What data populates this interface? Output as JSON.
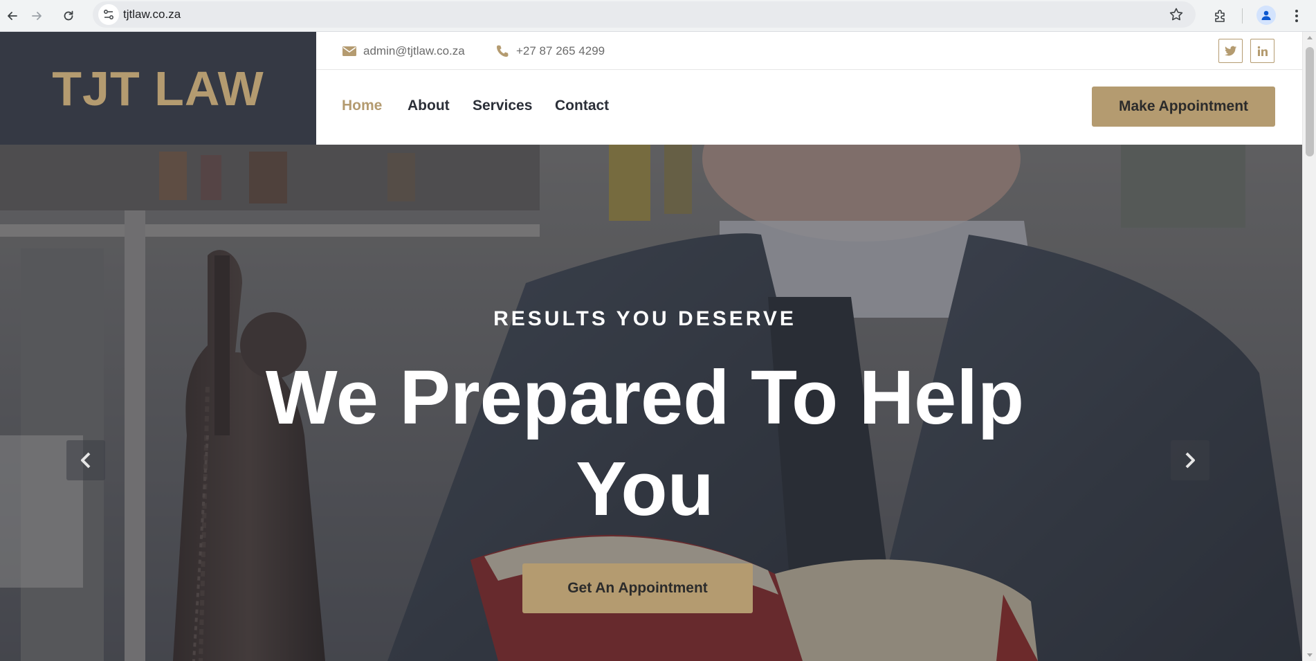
{
  "browser": {
    "url": "tjtlaw.co.za",
    "icons": {
      "back": "arrow-left-icon",
      "forward": "arrow-right-icon",
      "reload": "reload-icon",
      "site_info": "tune-icon",
      "bookmark": "star-icon",
      "extensions": "puzzle-icon",
      "profile": "person-icon",
      "menu": "more-vertical-icon"
    }
  },
  "site": {
    "logo": "TJT LAW",
    "topbar": {
      "email": "admin@tjtlaw.co.za",
      "phone": "+27 87 265 4299",
      "social": [
        "twitter-icon",
        "linkedin-icon"
      ]
    },
    "nav": {
      "items": [
        {
          "label": "Home",
          "active": true
        },
        {
          "label": "About",
          "active": false
        },
        {
          "label": "Services",
          "active": false
        },
        {
          "label": "Contact",
          "active": false
        }
      ],
      "cta": "Make Appointment"
    },
    "hero": {
      "kicker": "RESULTS YOU DESERVE",
      "title": "We Prepared To Help You",
      "button": "Get An Appointment",
      "arrows": [
        "chevron-left-icon",
        "chevron-right-icon"
      ]
    }
  },
  "colors": {
    "accent": "#b49b70",
    "dark": "#353944",
    "text_dark": "#2b2f38"
  }
}
